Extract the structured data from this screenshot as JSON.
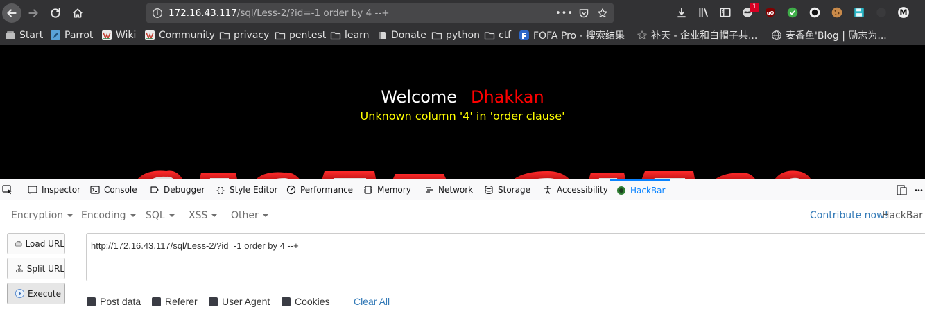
{
  "browser": {
    "url_host": "172.16.43.117",
    "url_path": "/sql/Less-2/?id=-1 order by 4 --+",
    "url_menu_label": "•••",
    "notification_badge": "1"
  },
  "bookmarks": [
    {
      "label": "Start",
      "icon": "start-icon"
    },
    {
      "label": "Parrot",
      "icon": "parrot-icon"
    },
    {
      "label": "Wiki",
      "icon": "wiki-icon"
    },
    {
      "label": "Community",
      "icon": "community-icon"
    },
    {
      "label": "privacy",
      "icon": "folder-icon"
    },
    {
      "label": "pentest",
      "icon": "folder-icon"
    },
    {
      "label": "learn",
      "icon": "folder-icon"
    },
    {
      "label": "Donate",
      "icon": "book-icon"
    },
    {
      "label": "python",
      "icon": "folder-icon"
    },
    {
      "label": "ctf",
      "icon": "folder-icon"
    },
    {
      "label": "FOFA Pro - 搜索结果",
      "icon": "fofa-icon"
    },
    {
      "label": "补天 - 企业和白帽子共...",
      "icon": "star-icon"
    },
    {
      "label": "麦香鱼'Blog | 励志为...",
      "icon": "globe-icon"
    }
  ],
  "page": {
    "welcome": "Welcome",
    "name": "Dhakkan",
    "error": "Unknown column '4' in 'order clause'"
  },
  "devtools": {
    "tabs": [
      {
        "label": "Inspector",
        "icon": "inspector-icon"
      },
      {
        "label": "Console",
        "icon": "console-icon"
      },
      {
        "label": "Debugger",
        "icon": "debugger-icon"
      },
      {
        "label": "Style Editor",
        "icon": "style-editor-icon"
      },
      {
        "label": "Performance",
        "icon": "performance-icon"
      },
      {
        "label": "Memory",
        "icon": "memory-icon"
      },
      {
        "label": "Network",
        "icon": "network-icon"
      },
      {
        "label": "Storage",
        "icon": "storage-icon"
      },
      {
        "label": "Accessibility",
        "icon": "accessibility-icon"
      },
      {
        "label": "HackBar",
        "icon": "hackbar-icon",
        "active": true
      }
    ]
  },
  "hackbar": {
    "menus": [
      "Encryption",
      "Encoding",
      "SQL",
      "XSS",
      "Other"
    ],
    "contribute": "Contribute now!",
    "version_label": "HackBar v",
    "load_url": "Load URL",
    "split_url": "Split URL",
    "execute": "Execute",
    "url_value": "http://172.16.43.117/sql/Less-2/?id=-1 order by 4 --+",
    "checkboxes": [
      "Post data",
      "Referer",
      "User Agent",
      "Cookies"
    ],
    "clear_all": "Clear All"
  },
  "colors": {
    "toolbar_bg": "#323234",
    "page_bg": "#000000",
    "welcome_name": "#ff0000",
    "error_text": "#ffff00",
    "link_blue": "#337ab7",
    "devtools_active": "#0a84ff"
  }
}
